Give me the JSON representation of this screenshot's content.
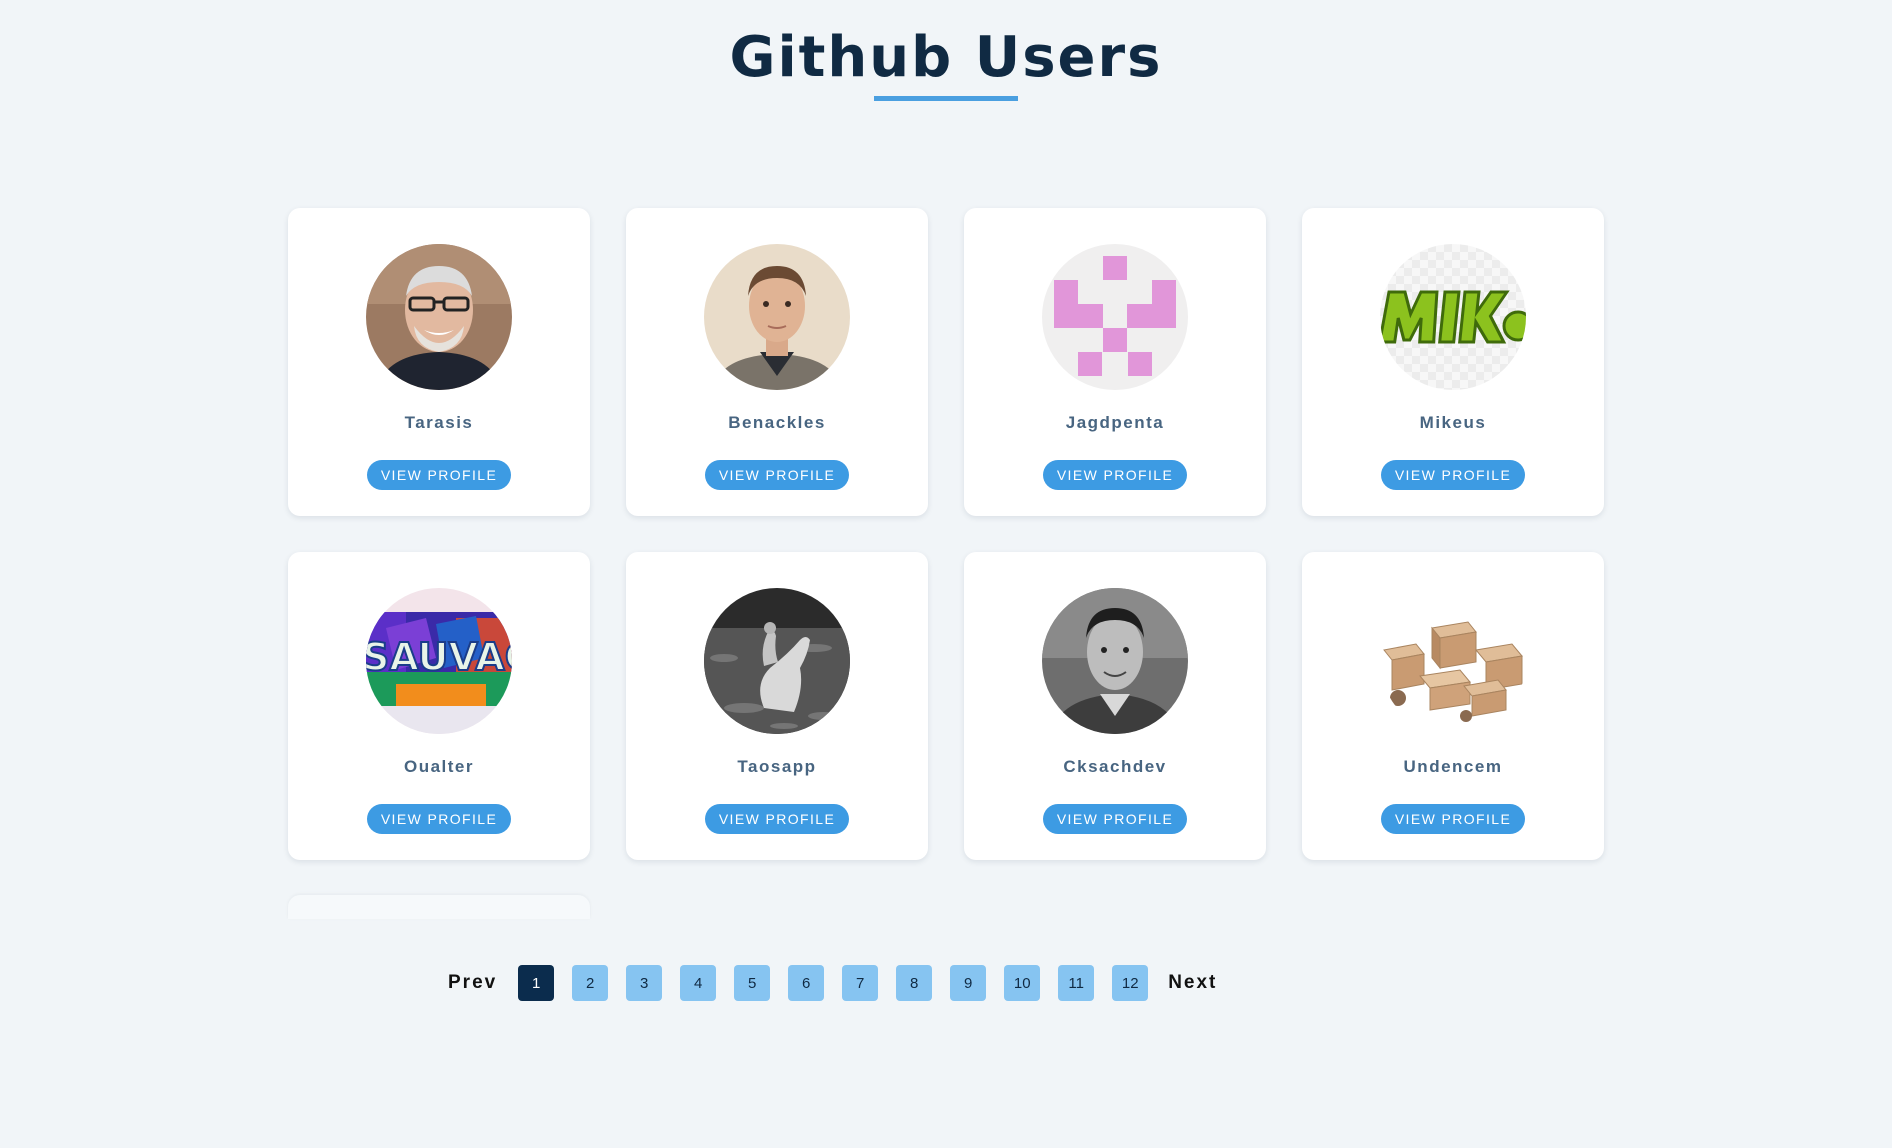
{
  "header": {
    "title": "Github Users",
    "accent_color": "#4a9fe0"
  },
  "users": [
    {
      "name": "Tarasis",
      "button_label": "View Profile",
      "avatar": "photo-older-man-glasses"
    },
    {
      "name": "Benackles",
      "button_label": "View Profile",
      "avatar": "photo-young-man"
    },
    {
      "name": "Jagdpenta",
      "button_label": "View Profile",
      "avatar": "identicon-pink"
    },
    {
      "name": "Mikeus",
      "button_label": "View Profile",
      "avatar": "logo-mike-green"
    },
    {
      "name": "Oualter",
      "button_label": "View Profile",
      "avatar": "colorful-sauvage-graffiti"
    },
    {
      "name": "Taosapp",
      "button_label": "View Profile",
      "avatar": "photo-bw-horse-rider"
    },
    {
      "name": "Cksachdev",
      "button_label": "View Profile",
      "avatar": "photo-bw-man-portrait"
    },
    {
      "name": "Undencem",
      "button_label": "View Profile",
      "avatar": "photo-cardboard-boxes"
    }
  ],
  "pagination": {
    "prev_label": "Prev",
    "next_label": "Next",
    "pages": [
      "1",
      "2",
      "3",
      "4",
      "5",
      "6",
      "7",
      "8",
      "9",
      "10",
      "11",
      "12"
    ],
    "current_page": "1"
  },
  "colors": {
    "background": "#f1f5f8",
    "title": "#102a43",
    "username": "#486581",
    "button": "#3d9be3",
    "page_button": "#86c4f1",
    "page_button_active": "#0b2c4d"
  }
}
